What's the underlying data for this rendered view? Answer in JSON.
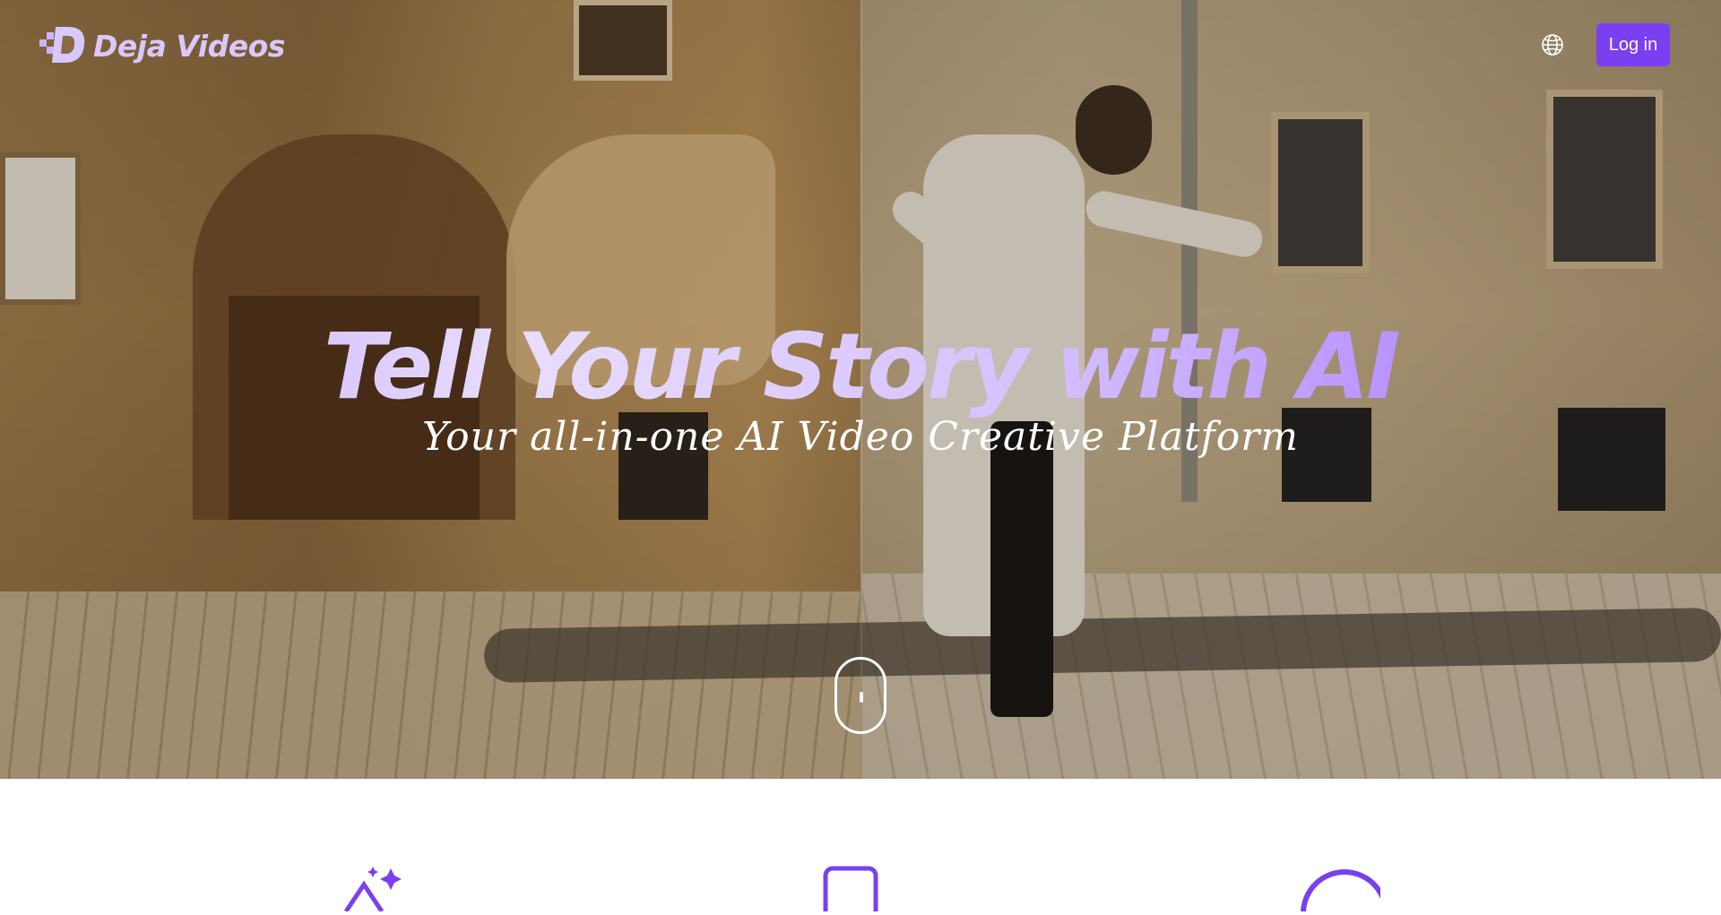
{
  "brand": {
    "name": "Deja Videos",
    "accent": "#7b3ff2",
    "headline_gradient": [
      "#bfa6ff",
      "#9f6bff"
    ]
  },
  "header": {
    "language_icon": "globe-icon",
    "login_label": "Log in"
  },
  "hero": {
    "title": "Tell Your Story with AI",
    "subtitle": "Your all-in-one AI Video Creative Platform",
    "scroll_hint_icon": "mouse-scroll-icon"
  },
  "features": {
    "icons": [
      "magic-edit-icon",
      "device-icon",
      "circle-icon"
    ]
  }
}
